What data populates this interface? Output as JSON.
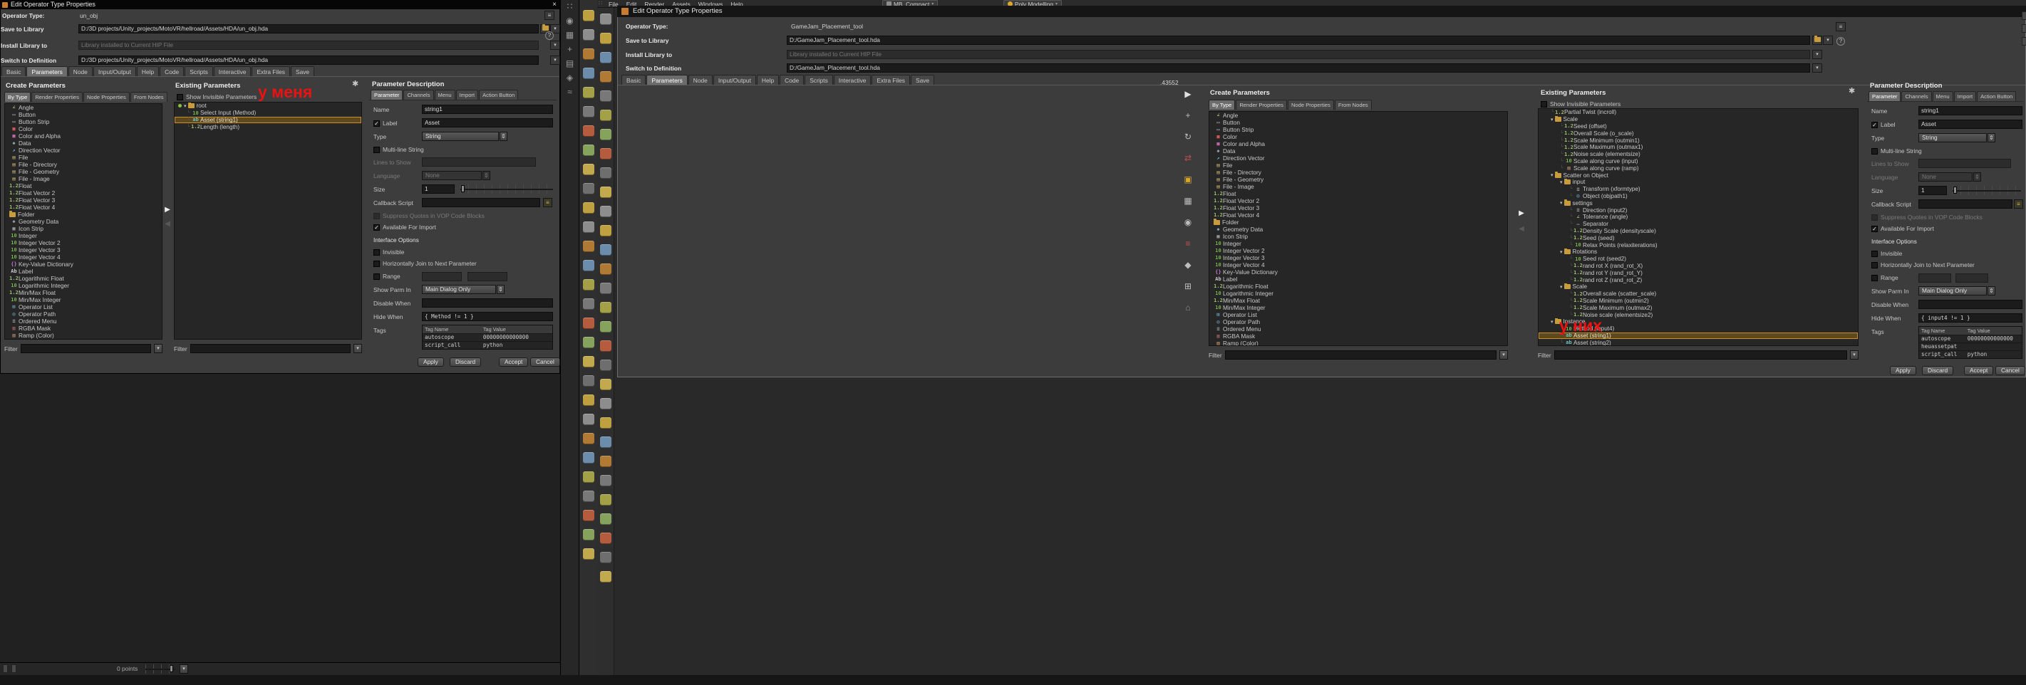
{
  "annotations": {
    "mine": "у меня",
    "theirs": "у них",
    "color": "#ec1212"
  },
  "shared": {
    "labels": {
      "create_title": "Create Parameters",
      "existing_title": "Existing Parameters",
      "desc_title": "Parameter Description",
      "show_invisible": "Show Invisible Parameters",
      "filter": "Filter",
      "operator_type": "Operator Type:",
      "save_to_library": "Save to Library",
      "install_library": "Install Library to",
      "switch_def": "Switch to Definition",
      "name": "Name",
      "label": "Label",
      "type": "Type",
      "multiline": "Multi-line String",
      "lines_to_show": "Lines to Show",
      "language": "Language",
      "size": "Size",
      "callback": "Callback Script",
      "suppress": "Suppress Quotes in VOP Code Blocks",
      "avail_import": "Available For Import",
      "iface": "Interface Options",
      "invisible": "Invisible",
      "hjoin": "Horizontally Join to Next Parameter",
      "range": "Range",
      "show_parm_in": "Show Parm In",
      "disable_when": "Disable When",
      "hide_when": "Hide When",
      "tags": "Tags",
      "tag_name": "Tag Name",
      "tag_value": "Tag Value",
      "apply": "Apply",
      "discard": "Discard",
      "accept": "Accept",
      "cancel": "Cancel"
    },
    "dialog_tabs": [
      {
        "label": "Basic"
      },
      {
        "label": "Parameters",
        "sel": true
      },
      {
        "label": "Node"
      },
      {
        "label": "Input/Output"
      },
      {
        "label": "Help"
      },
      {
        "label": "Code"
      },
      {
        "label": "Scripts"
      },
      {
        "label": "Interactive"
      },
      {
        "label": "Extra Files"
      },
      {
        "label": "Save"
      }
    ],
    "type_tabs": [
      {
        "label": "By Type",
        "sel": true
      },
      {
        "label": "Render Properties"
      },
      {
        "label": "Node Properties"
      },
      {
        "label": "From Nodes"
      }
    ],
    "desc_tabs": [
      {
        "label": "Parameter",
        "sel": true
      },
      {
        "label": "Channels"
      },
      {
        "label": "Menu"
      },
      {
        "label": "Import"
      },
      {
        "label": "Action Button"
      }
    ],
    "param_types": [
      {
        "label": "Angle",
        "icon": "∠",
        "color": "#9fc06f"
      },
      {
        "label": "Button",
        "icon": "▭",
        "color": "#b0b0b0"
      },
      {
        "label": "Button Strip",
        "icon": "▭",
        "color": "#b0b0b0"
      },
      {
        "label": "Color",
        "icon": "■",
        "color": "#cc5555"
      },
      {
        "label": "Color and Alpha",
        "icon": "■",
        "color": "#bb66aa"
      },
      {
        "label": "Data",
        "icon": "◆",
        "color": "#8fa3b0"
      },
      {
        "label": "Direction Vector",
        "icon": "↗",
        "color": "#6fa8c8"
      },
      {
        "label": "File",
        "icon": "▤",
        "color": "#c8b06f"
      },
      {
        "label": "File - Directory",
        "icon": "▤",
        "color": "#c8b06f"
      },
      {
        "label": "File - Geometry",
        "icon": "▤",
        "color": "#c8b06f"
      },
      {
        "label": "File - Image",
        "icon": "▤",
        "color": "#c8b06f"
      },
      {
        "label": "Float",
        "icon": "1.2",
        "color": "#9fc06f"
      },
      {
        "label": "Float Vector 2",
        "icon": "1.2",
        "color": "#9fc06f"
      },
      {
        "label": "Float Vector 3",
        "icon": "1.2",
        "color": "#9fc06f"
      },
      {
        "label": "Float Vector 4",
        "icon": "1.2",
        "color": "#9fc06f"
      },
      {
        "label": "Folder",
        "icon": "FOLDER",
        "color": "#c89b3c"
      },
      {
        "label": "Geometry Data",
        "icon": "◆",
        "color": "#8fa3b0"
      },
      {
        "label": "Icon Strip",
        "icon": "▦",
        "color": "#b0b0b0"
      },
      {
        "label": "Integer",
        "icon": "10",
        "color": "#76b24a"
      },
      {
        "label": "Integer Vector 2",
        "icon": "10",
        "color": "#76b24a"
      },
      {
        "label": "Integer Vector 3",
        "icon": "10",
        "color": "#76b24a"
      },
      {
        "label": "Integer Vector 4",
        "icon": "10",
        "color": "#76b24a"
      },
      {
        "label": "Key-Value Dictionary",
        "icon": "{}",
        "color": "#b777c9"
      },
      {
        "label": "Label",
        "icon": "Ab",
        "color": "#c8c8c8"
      },
      {
        "label": "Logarithmic Float",
        "icon": "1.2",
        "color": "#9fc06f"
      },
      {
        "label": "Logarithmic Integer",
        "icon": "10",
        "color": "#76b24a"
      },
      {
        "label": "Min/Max Float",
        "icon": "1.2",
        "color": "#9fc06f"
      },
      {
        "label": "Min/Max Integer",
        "icon": "10",
        "color": "#76b24a"
      },
      {
        "label": "Operator List",
        "icon": "⊞",
        "color": "#6fa8c8"
      },
      {
        "label": "Operator Path",
        "icon": "◎",
        "color": "#6fa8c8"
      },
      {
        "label": "Ordered Menu",
        "icon": "≡",
        "color": "#b0b0b0"
      },
      {
        "label": "RGBA Mask",
        "icon": "▥",
        "color": "#c06f6f"
      },
      {
        "label": "Ramp (Color)",
        "icon": "▨",
        "color": "#c0906f"
      }
    ]
  },
  "left": {
    "window_title": "Edit Operator Type Properties",
    "operator_type": "un_obj",
    "save_path": "D:/3D projects/Unity_projects/MotoVR/hellroad/Assets/HDA/un_obj.hda",
    "install_value": "Library installed to Current HIP File",
    "switch_value": "D:/3D projects/Unity_projects/MotoVR/hellroad/Assets/HDA/un_obj.hda",
    "tree": [
      {
        "label": "root",
        "level": 0,
        "root": true,
        "folder": true
      },
      {
        "label": "Select Input (Method)",
        "icon": "10",
        "color": "#76b24a",
        "level": 1
      },
      {
        "label": "Asset (string1)",
        "icon": "ab",
        "color": "#6fc0b8",
        "level": 1,
        "sel": true
      },
      {
        "label": "Length (length)",
        "icon": "1.2",
        "color": "#9fc06f",
        "level": 1
      }
    ],
    "desc": {
      "name": "string1",
      "label": "Asset",
      "type": "String",
      "language": "None",
      "size": "1",
      "show_parm_in": "Main Dialog Only",
      "disable_when": "",
      "hide_when": "{ Method != 1 }",
      "tags": [
        {
          "name": "autoscope",
          "value": "00000000000000"
        },
        {
          "name": "script_call",
          "value": "python"
        }
      ]
    },
    "status": "0 points"
  },
  "right": {
    "window_title": "Edit Operator Type Properties",
    "operator_type": "GameJam_Placement_tool",
    "save_path": "D:/GameJam_Placement_tool.hda",
    "install_value": "Library installed to Current HIP File",
    "switch_value": "D:/GameJam_Placement_tool.hda",
    "readout": ".43552",
    "menu": [
      {
        "label": "File"
      },
      {
        "label": "Edit"
      },
      {
        "label": "Render"
      },
      {
        "label": "Assets"
      },
      {
        "label": "Windows"
      },
      {
        "label": "Help"
      }
    ],
    "chips": [
      {
        "label": "MB_Compact"
      },
      {
        "label": "Poly Modelling"
      }
    ],
    "side_tools": [
      {
        "glyph": "▶",
        "color": "#e0e0e0",
        "name": "select-tool-icon"
      },
      {
        "glyph": "+",
        "color": "#bdbdbd",
        "name": "move-tool-icon"
      },
      {
        "glyph": "↻",
        "color": "#bdbdbd",
        "name": "rotate-tool-icon"
      },
      {
        "glyph": "⇄",
        "color": "#c0504d",
        "name": "transform-tool-icon"
      },
      {
        "glyph": "▣",
        "color": "#d9a62e",
        "name": "snap-tool-icon"
      },
      {
        "glyph": "▦",
        "color": "#bdbdbd",
        "name": "grid-tool-icon"
      },
      {
        "glyph": "◉",
        "color": "#bdbdbd",
        "name": "camera-tool-icon"
      },
      {
        "glyph": "≡",
        "color": "#c0504d",
        "name": "list-tool-icon"
      },
      {
        "glyph": "◆",
        "color": "#bdbdbd",
        "name": "geometry-tool-icon"
      },
      {
        "glyph": "⊞",
        "color": "#bdbdbd",
        "name": "add-tool-icon"
      },
      {
        "glyph": "⌂",
        "color": "#8d8d8d",
        "name": "home-tool-icon"
      }
    ],
    "tree": [
      {
        "label": "Partial Twist (incroll)",
        "icon": "1.2",
        "color": "#9fc06f",
        "level": 1
      },
      {
        "label": "Scale",
        "level": 1,
        "folder": true
      },
      {
        "label": "Seed (offset)",
        "icon": "1.2",
        "color": "#9fc06f",
        "level": 2
      },
      {
        "label": "Overall Scale (o_scale)",
        "icon": "1.2",
        "color": "#9fc06f",
        "level": 2
      },
      {
        "label": "Scale Minimum (outmin1)",
        "icon": "1.2",
        "color": "#9fc06f",
        "level": 2
      },
      {
        "label": "Scale Maximum (outmax1)",
        "icon": "1.2",
        "color": "#9fc06f",
        "level": 2
      },
      {
        "label": "Noise scale (elementsize)",
        "icon": "1.2",
        "color": "#9fc06f",
        "level": 2
      },
      {
        "label": "Scale along curve (input)",
        "icon": "10",
        "color": "#76b24a",
        "level": 2
      },
      {
        "label": "Scale along curve (ramp)",
        "icon": "▨",
        "color": "#c0906f",
        "level": 2
      },
      {
        "label": "Scatter on Object",
        "level": 1,
        "folder": true
      },
      {
        "label": "input",
        "level": 2,
        "folder": true
      },
      {
        "label": "Transform (xformtype)",
        "icon": "≡",
        "color": "#b0b0b0",
        "level": 3
      },
      {
        "label": "Object (objpath1)",
        "icon": "◎",
        "color": "#6fa8c8",
        "level": 3
      },
      {
        "label": "settings",
        "level": 2,
        "folder": true
      },
      {
        "label": "Direction (input2)",
        "icon": "≡",
        "color": "#b0b0b0",
        "level": 3
      },
      {
        "label": "Tolerance (angle)",
        "icon": "∠",
        "color": "#9fc06f",
        "level": 3
      },
      {
        "label": "Separator",
        "icon": "—",
        "color": "#9a9a9a",
        "level": 3
      },
      {
        "label": "Density Scale (densityscale)",
        "icon": "1.2",
        "color": "#9fc06f",
        "level": 3
      },
      {
        "label": "Seed (seed)",
        "icon": "1.2",
        "color": "#9fc06f",
        "level": 3
      },
      {
        "label": "Relax Points (relaxiterations)",
        "icon": "10",
        "color": "#76b24a",
        "level": 3
      },
      {
        "label": "Rotations",
        "level": 2,
        "folder": true
      },
      {
        "label": "Seed rot (seed2)",
        "icon": "10",
        "color": "#76b24a",
        "level": 3
      },
      {
        "label": "rand rot X (rand_rot_X)",
        "icon": "1.2",
        "color": "#9fc06f",
        "level": 3
      },
      {
        "label": "rand rot Y (rand_rot_Y)",
        "icon": "1.2",
        "color": "#9fc06f",
        "level": 3
      },
      {
        "label": "rand rot Z (rand_rot_Z)",
        "icon": "1.2",
        "color": "#9fc06f",
        "level": 3
      },
      {
        "label": "Scale",
        "level": 2,
        "folder": true
      },
      {
        "label": "Overall scale (scatter_scale)",
        "icon": "1.2",
        "color": "#9fc06f",
        "level": 3
      },
      {
        "label": "Scale Minimum (outmin2)",
        "icon": "1.2",
        "color": "#9fc06f",
        "level": 3
      },
      {
        "label": "Scale Maximum (outmax2)",
        "icon": "1.2",
        "color": "#9fc06f",
        "level": 3
      },
      {
        "label": "Noise scale (elementsize2)",
        "icon": "1.2",
        "color": "#9fc06f",
        "level": 3
      },
      {
        "label": "Instance",
        "level": 1,
        "folder": true
      },
      {
        "label": "Method (input4)",
        "icon": "10",
        "color": "#76b24a",
        "level": 2
      },
      {
        "label": "Asset (string1)",
        "icon": "ab",
        "color": "#6fc0b8",
        "level": 2,
        "sel": true
      },
      {
        "label": "Asset (string2)",
        "icon": "ab",
        "color": "#6fc0b8",
        "level": 2
      }
    ],
    "desc": {
      "name": "string1",
      "label": "Asset",
      "type": "String",
      "language": "None",
      "size": "1",
      "show_parm_in": "Main Dialog Only",
      "disable_when": "",
      "hide_when": "{ input4 != 1 }",
      "tags": [
        {
          "name": "autoscope",
          "value": "00000000000000"
        },
        {
          "name": "heuassetpat",
          "value": ""
        },
        {
          "name": "script_call",
          "value": "python"
        }
      ]
    }
  },
  "strips": {
    "stripA_icons": [
      {
        "glyph": "∷",
        "name": "drag-grip-icon"
      },
      {
        "glyph": "◉",
        "name": "camera-icon"
      },
      {
        "glyph": "▦",
        "name": "grid-icon"
      },
      {
        "glyph": "+",
        "name": "crosshair-icon"
      },
      {
        "glyph": "▤",
        "name": "layers-icon"
      },
      {
        "glyph": "◈",
        "name": "gem-icon"
      },
      {
        "glyph": "≈",
        "name": "waves-icon"
      }
    ],
    "shelf_left": [
      "#bfa041",
      "#8d8d8d",
      "#b07a34",
      "#6b8dab",
      "#a3a048",
      "#787878",
      "#b65c3e",
      "#85a35c",
      "#c2a94e",
      "#6e6e6e",
      "#bfa041",
      "#8d8d8d",
      "#b07a34",
      "#6b8dab",
      "#a3a048",
      "#787878",
      "#b65c3e",
      "#85a35c",
      "#c2a94e",
      "#6e6e6e",
      "#bfa041",
      "#8d8d8d",
      "#b07a34",
      "#6b8dab",
      "#a3a048",
      "#787878",
      "#b65c3e",
      "#85a35c",
      "#c2a94e"
    ],
    "shelf_right": [
      "#8d8d8d",
      "#bfa041",
      "#6b8dab",
      "#b07a34",
      "#787878",
      "#a3a048",
      "#85a35c",
      "#b65c3e",
      "#6e6e6e",
      "#c2a94e",
      "#8d8d8d",
      "#bfa041",
      "#6b8dab",
      "#b07a34",
      "#787878",
      "#a3a048",
      "#85a35c",
      "#b65c3e",
      "#6e6e6e",
      "#c2a94e",
      "#8d8d8d",
      "#bfa041",
      "#6b8dab",
      "#b07a34",
      "#787878",
      "#a3a048",
      "#85a35c",
      "#b65c3e",
      "#6e6e6e",
      "#c2a94e"
    ]
  }
}
